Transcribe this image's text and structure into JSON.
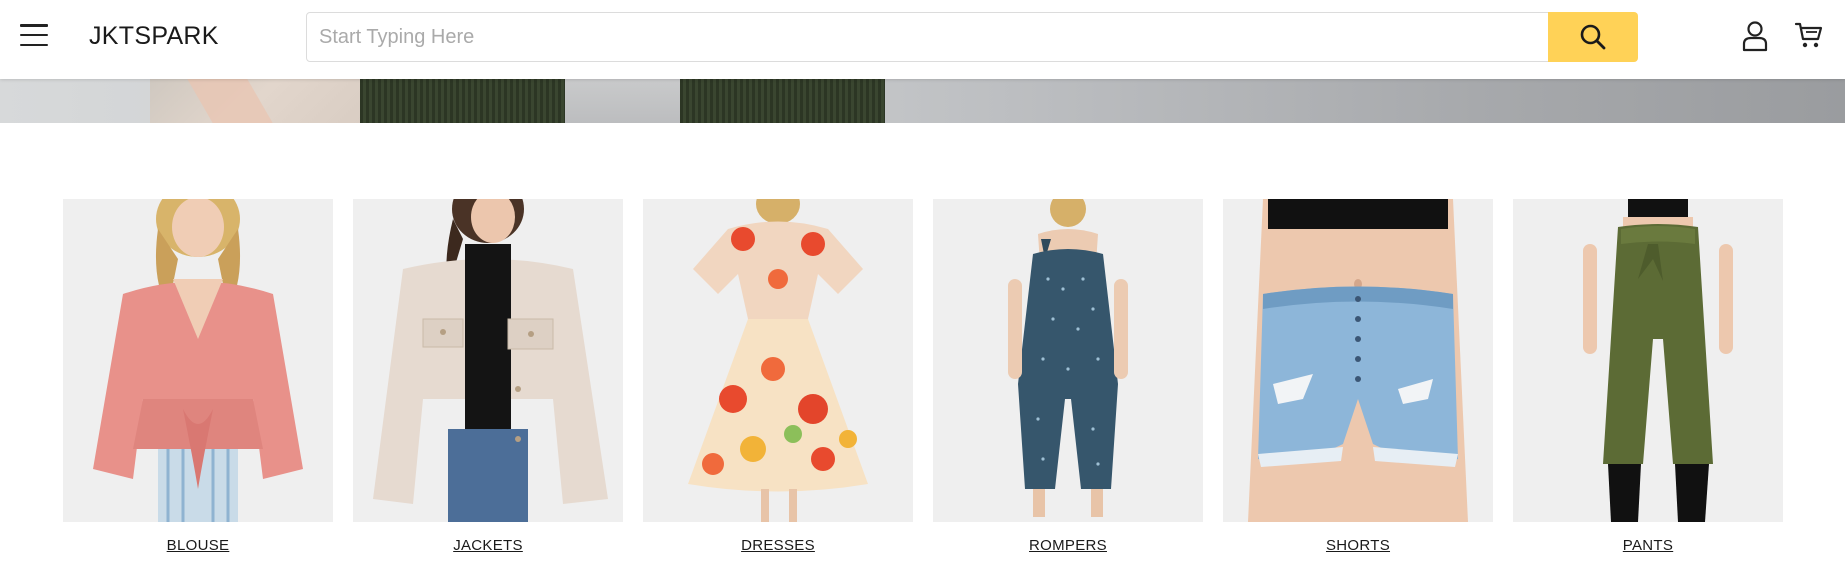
{
  "header": {
    "brand": "JKTSPARK",
    "menu_icon": "hamburger-menu-icon",
    "search": {
      "placeholder": "Start Typing Here",
      "value": "",
      "button_icon": "search-icon"
    },
    "account_icon": "user-icon",
    "cart_icon": "cart-icon"
  },
  "colors": {
    "accent": "#ffd257",
    "tile_bg": "#efefef"
  },
  "categories": [
    {
      "label": "BLOUSE"
    },
    {
      "label": "JACKETS"
    },
    {
      "label": "DRESSES"
    },
    {
      "label": "ROMPERS"
    },
    {
      "label": "SHORTS"
    },
    {
      "label": "PANTS"
    }
  ]
}
